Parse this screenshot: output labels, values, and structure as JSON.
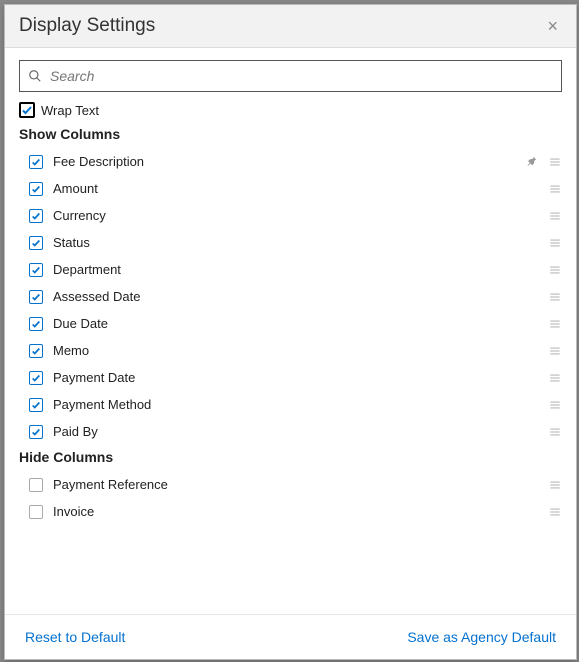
{
  "dialog": {
    "title": "Display Settings",
    "search_placeholder": "Search",
    "wrap_text_label": "Wrap Text",
    "wrap_text_checked": true,
    "show_columns_label": "Show Columns",
    "hide_columns_label": "Hide Columns",
    "show_columns": [
      {
        "label": "Fee Description",
        "checked": true,
        "pinned": true
      },
      {
        "label": "Amount",
        "checked": true,
        "pinned": false
      },
      {
        "label": "Currency",
        "checked": true,
        "pinned": false
      },
      {
        "label": "Status",
        "checked": true,
        "pinned": false
      },
      {
        "label": "Department",
        "checked": true,
        "pinned": false
      },
      {
        "label": "Assessed Date",
        "checked": true,
        "pinned": false
      },
      {
        "label": "Due Date",
        "checked": true,
        "pinned": false
      },
      {
        "label": "Memo",
        "checked": true,
        "pinned": false
      },
      {
        "label": "Payment Date",
        "checked": true,
        "pinned": false
      },
      {
        "label": "Payment Method",
        "checked": true,
        "pinned": false
      },
      {
        "label": "Paid By",
        "checked": true,
        "pinned": false
      }
    ],
    "hide_columns": [
      {
        "label": "Payment Reference",
        "checked": false,
        "pinned": false
      },
      {
        "label": "Invoice",
        "checked": false,
        "pinned": false
      }
    ],
    "footer": {
      "reset_label": "Reset to Default",
      "save_label": "Save as Agency Default"
    }
  }
}
